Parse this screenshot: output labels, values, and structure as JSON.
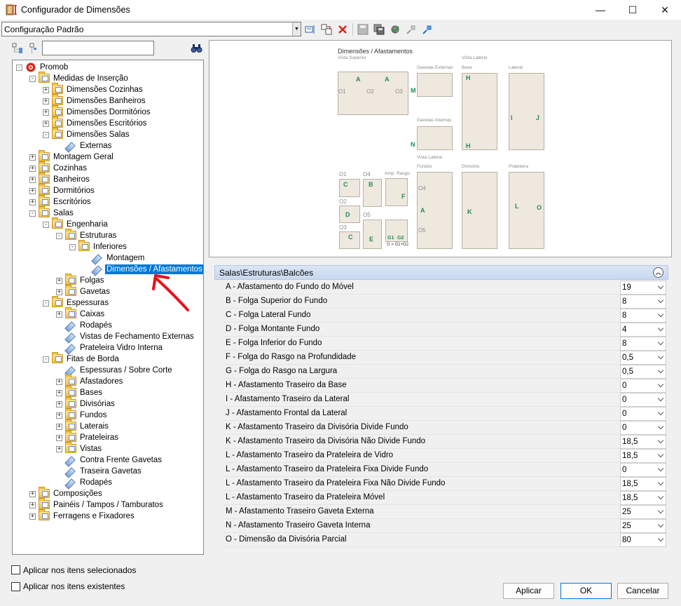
{
  "window": {
    "title": "Configurador de Dimensões",
    "minimize": "—",
    "maximize": "☐",
    "close": "✕"
  },
  "toolbar": {
    "config_value": "Configuração Padrão"
  },
  "tree": [
    {
      "label": "Promob",
      "level": 0,
      "type": "root",
      "exp": "-"
    },
    {
      "label": "Medidas de Inserção",
      "level": 1,
      "type": "folder",
      "exp": "-"
    },
    {
      "label": "Dimensões Cozinhas",
      "level": 2,
      "type": "folder",
      "exp": "+"
    },
    {
      "label": "Dimensões Banheiros",
      "level": 2,
      "type": "folder",
      "exp": "+"
    },
    {
      "label": "Dimensões Dormitórios",
      "level": 2,
      "type": "folder",
      "exp": "+"
    },
    {
      "label": "Dimensões Escritórios",
      "level": 2,
      "type": "folder",
      "exp": "+"
    },
    {
      "label": "Dimensões Salas",
      "level": 2,
      "type": "folder",
      "exp": "-"
    },
    {
      "label": "Externas",
      "level": 3,
      "type": "leaf",
      "exp": ""
    },
    {
      "label": "Montagem Geral",
      "level": 1,
      "type": "folder",
      "exp": "+"
    },
    {
      "label": "Cozinhas",
      "level": 1,
      "type": "folder",
      "exp": "+"
    },
    {
      "label": "Banheiros",
      "level": 1,
      "type": "folder",
      "exp": "+"
    },
    {
      "label": "Dormitórios",
      "level": 1,
      "type": "folder",
      "exp": "+"
    },
    {
      "label": "Escritórios",
      "level": 1,
      "type": "folder",
      "exp": "+"
    },
    {
      "label": "Salas",
      "level": 1,
      "type": "folder",
      "exp": "-"
    },
    {
      "label": "Engenharia",
      "level": 2,
      "type": "folder",
      "exp": "-"
    },
    {
      "label": "Estruturas",
      "level": 3,
      "type": "folder",
      "exp": "-"
    },
    {
      "label": "Inferiores",
      "level": 4,
      "type": "folder",
      "exp": "-"
    },
    {
      "label": "Montagem",
      "level": 5,
      "type": "leaf",
      "exp": ""
    },
    {
      "label": "Dimensões / Afastamentos",
      "level": 5,
      "type": "leaf",
      "exp": "",
      "selected": true
    },
    {
      "label": "Folgas",
      "level": 3,
      "type": "folder",
      "exp": "+"
    },
    {
      "label": "Gavetas",
      "level": 3,
      "type": "folder",
      "exp": "+"
    },
    {
      "label": "Espessuras",
      "level": 2,
      "type": "folder",
      "exp": "-"
    },
    {
      "label": "Caixas",
      "level": 3,
      "type": "folder",
      "exp": "+"
    },
    {
      "label": "Rodapés",
      "level": 3,
      "type": "leaf",
      "exp": ""
    },
    {
      "label": "Vistas de Fechamento Externas",
      "level": 3,
      "type": "leaf",
      "exp": ""
    },
    {
      "label": "Prateleira Vidro Interna",
      "level": 3,
      "type": "leaf",
      "exp": ""
    },
    {
      "label": "Fitas de Borda",
      "level": 2,
      "type": "folder",
      "exp": "-"
    },
    {
      "label": "Espessuras / Sobre Corte",
      "level": 3,
      "type": "leaf",
      "exp": ""
    },
    {
      "label": "Afastadores",
      "level": 3,
      "type": "folder",
      "exp": "+"
    },
    {
      "label": "Bases",
      "level": 3,
      "type": "folder",
      "exp": "+"
    },
    {
      "label": "Divisórias",
      "level": 3,
      "type": "folder",
      "exp": "+"
    },
    {
      "label": "Fundos",
      "level": 3,
      "type": "folder",
      "exp": "+"
    },
    {
      "label": "Laterais",
      "level": 3,
      "type": "folder",
      "exp": "+"
    },
    {
      "label": "Prateleiras",
      "level": 3,
      "type": "folder",
      "exp": "+"
    },
    {
      "label": "Vistas",
      "level": 3,
      "type": "folder",
      "exp": "+"
    },
    {
      "label": "Contra Frente Gavetas",
      "level": 3,
      "type": "leaf",
      "exp": ""
    },
    {
      "label": "Traseira Gavetas",
      "level": 3,
      "type": "leaf",
      "exp": ""
    },
    {
      "label": "Rodapés",
      "level": 3,
      "type": "leaf",
      "exp": ""
    },
    {
      "label": "Composições",
      "level": 1,
      "type": "folder",
      "exp": "+"
    },
    {
      "label": "Painéis / Tampos / Tamburatos",
      "level": 1,
      "type": "folder",
      "exp": "+"
    },
    {
      "label": "Ferragens e Fixadores",
      "level": 1,
      "type": "folder",
      "exp": "+"
    }
  ],
  "preview": {
    "title": "Dimensões / Afastamentos",
    "labels": {
      "vista_superior": "Vista Superior",
      "vista_lateral": "Vista Lateral",
      "gavetas_externas": "Gavetas Externas",
      "base": "Base",
      "lateral": "Lateral",
      "gavetas_internas": "Gavetas Internas",
      "vista_lateral2": "Vista Lateral",
      "fundos": "Fundos",
      "divisoria": "Divisória",
      "prateleira": "Prateleira",
      "amp_rasgo": "Amp. Rasgo",
      "o1": "O1",
      "o2": "O2",
      "o3": "O3",
      "o4": "O4",
      "o5": "O5",
      "formula": "G = G1+G2",
      "g1": "G1",
      "g2": "G2"
    }
  },
  "section": {
    "title": "Salas\\Estruturas\\Balcões"
  },
  "properties": [
    {
      "label": "A - Afastamento do Fundo do Móvel",
      "value": "19"
    },
    {
      "label": "B - Folga Superior do Fundo",
      "value": "8"
    },
    {
      "label": "C - Folga Lateral Fundo",
      "value": "8"
    },
    {
      "label": "D - Folga Montante Fundo",
      "value": "4"
    },
    {
      "label": "E - Folga Inferior do Fundo",
      "value": "8"
    },
    {
      "label": "F - Folga do Rasgo na Profundidade",
      "value": "0,5"
    },
    {
      "label": "G - Folga do Rasgo na Largura",
      "value": "0,5"
    },
    {
      "label": "H - Afastamento Traseiro da Base",
      "value": "0"
    },
    {
      "label": "I - Afastamento Traseiro da Lateral",
      "value": "0"
    },
    {
      "label": "J - Afastamento Frontal da Lateral",
      "value": "0"
    },
    {
      "label": "K - Afastamento Traseiro da Divisória Divide Fundo",
      "value": "0"
    },
    {
      "label": "K - Afastamento Traseiro da Divisória Não Divide Fundo",
      "value": "18,5"
    },
    {
      "label": "L - Afastamento Traseiro da Prateleira de Vidro",
      "value": "18,5"
    },
    {
      "label": "L - Afastamento Traseiro da Prateleira Fixa Divide Fundo",
      "value": "0"
    },
    {
      "label": "L - Afastamento Traseiro da Prateleira Fixa Não Divide Fundo",
      "value": "18,5"
    },
    {
      "label": "L - Afastamento Traseiro da Prateleira Móvel",
      "value": "18,5"
    },
    {
      "label": "M - Afastamento Traseiro Gaveta Externa",
      "value": "25"
    },
    {
      "label": "N - Afastamento Traseiro Gaveta Interna",
      "value": "25"
    },
    {
      "label": "O - Dimensão da Divisória Parcial",
      "value": "80"
    }
  ],
  "options": {
    "apply_selected": "Aplicar nos itens selecionados",
    "apply_existing": "Aplicar nos itens existentes"
  },
  "buttons": {
    "apply": "Aplicar",
    "ok": "OK",
    "cancel": "Cancelar"
  }
}
